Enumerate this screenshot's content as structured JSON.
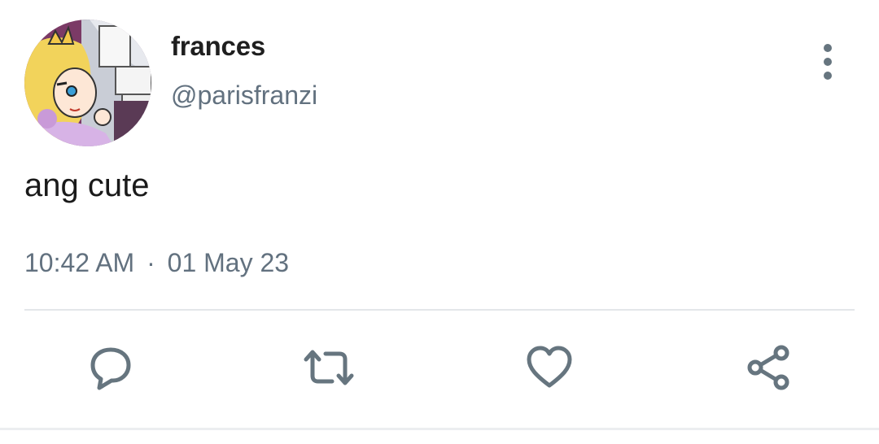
{
  "user": {
    "display_name": "frances",
    "handle": "@parisfranzi",
    "avatar": "avatar-cartoon-princess"
  },
  "tweet": {
    "text": "ang cute",
    "time": "10:42 AM",
    "separator": "·",
    "date": "01 May 23"
  },
  "actions": {
    "reply_icon": "reply-icon",
    "retweet_icon": "retweet-icon",
    "like_icon": "heart-icon",
    "share_icon": "share-icon",
    "more_icon": "more-vertical-icon"
  },
  "colors": {
    "icon": "#66757f",
    "secondary_text": "#62717f",
    "primary_text": "#1a1a1a"
  }
}
